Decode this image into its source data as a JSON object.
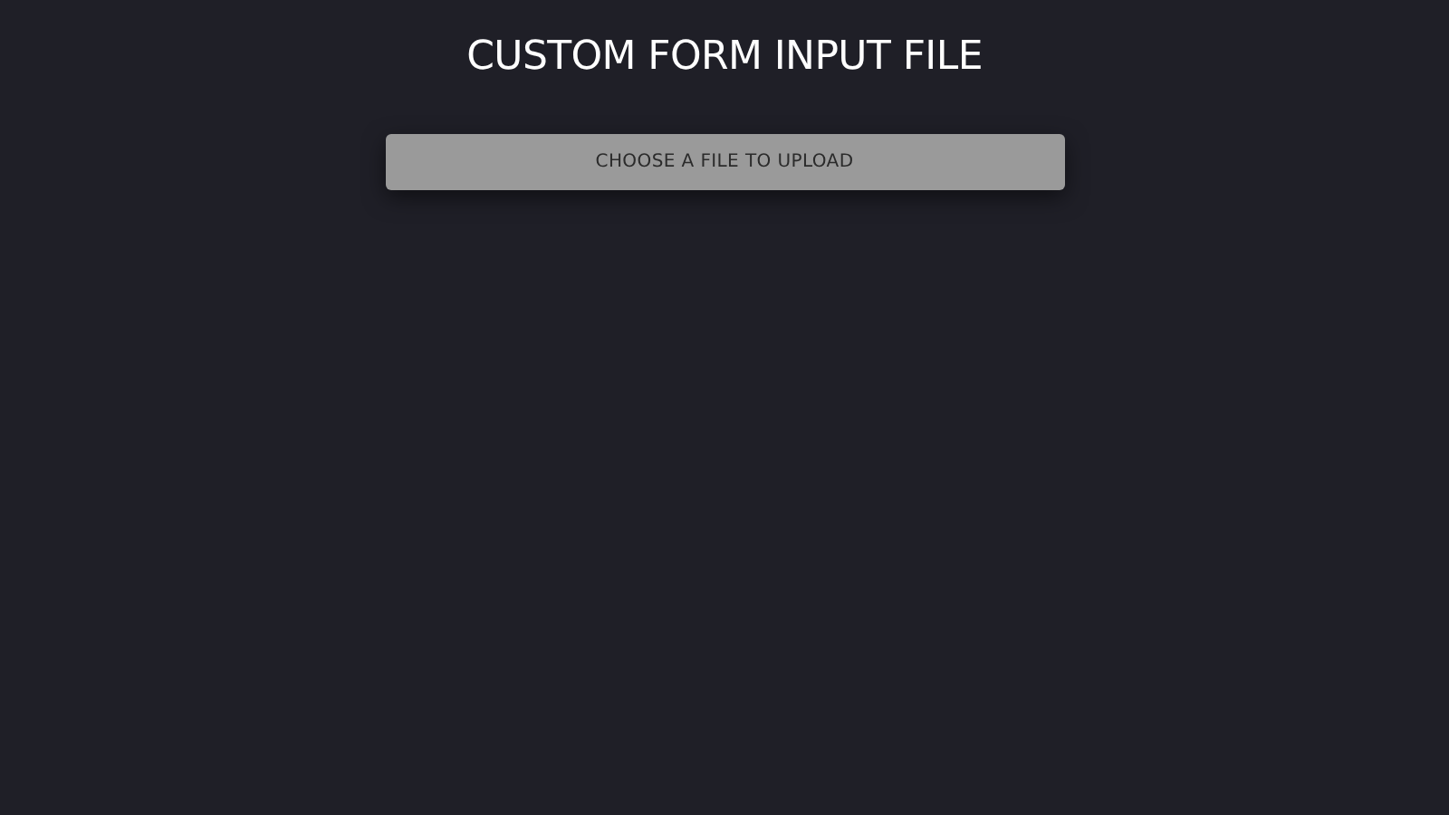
{
  "title": "CUSTOM FORM INPUT FILE",
  "upload_button": {
    "label": "CHOOSE A FILE TO UPLOAD"
  }
}
